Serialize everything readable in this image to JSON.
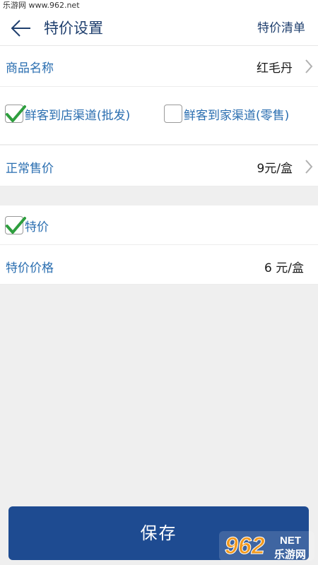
{
  "watermark": {
    "top_text": "乐游网 www.962.net"
  },
  "header": {
    "title": "特价设置",
    "action": "特价清单"
  },
  "product": {
    "label": "商品名称",
    "value": "红毛丹"
  },
  "channels": {
    "option1": {
      "label": "鲜客到店渠道(批发)",
      "checked": true
    },
    "option2": {
      "label": "鲜客到家渠道(零售)",
      "checked": false
    }
  },
  "price": {
    "label": "正常售价",
    "value": "9元/盒"
  },
  "special": {
    "label": "特价",
    "checked": true
  },
  "special_price": {
    "label": "特价价格",
    "value": "6 元/盒"
  },
  "footer": {
    "save_label": "保存"
  },
  "logo": {
    "text": "962",
    "sub": "乐游网",
    "suffix": "NET"
  },
  "colors": {
    "accent": "#1e4b91",
    "label_blue": "#2a6eb0",
    "check_green": "#2e9e3e"
  }
}
